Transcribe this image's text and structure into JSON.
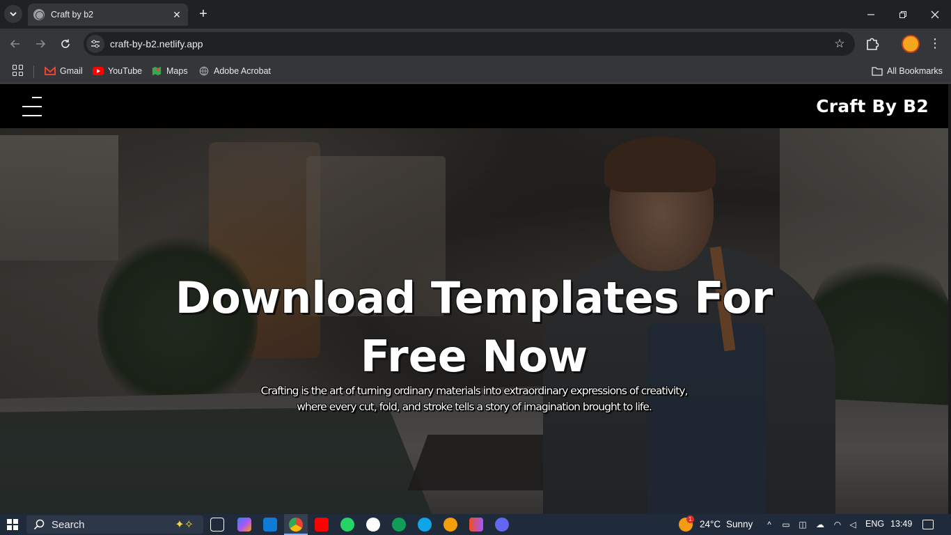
{
  "browser": {
    "tab_title": "Craft by b2",
    "url": "craft-by-b2.netlify.app",
    "bookmarks": [
      {
        "label": "Gmail",
        "icon": "gmail-icon",
        "color": "#ea4335"
      },
      {
        "label": "YouTube",
        "icon": "youtube-icon",
        "color": "#ff0000"
      },
      {
        "label": "Maps",
        "icon": "maps-icon",
        "color": "#34a853"
      },
      {
        "label": "Adobe Acrobat",
        "icon": "globe-icon",
        "color": "#9aa0a6"
      }
    ],
    "all_bookmarks": "All Bookmarks"
  },
  "site": {
    "brand": "Craft By B2",
    "hero_title_line1": "Download Templates For",
    "hero_title_line2": "Free Now",
    "hero_sub_line1": "Crafting is the art of turning ordinary materials into extraordinary expressions of creativity,",
    "hero_sub_line2": "where every cut, fold, and stroke tells a story of imagination brought to life."
  },
  "taskbar": {
    "search_label": "Search",
    "temperature": "24°C",
    "weather": "Sunny",
    "weather_badge": "1",
    "language": "ENG",
    "time": "13:49"
  }
}
